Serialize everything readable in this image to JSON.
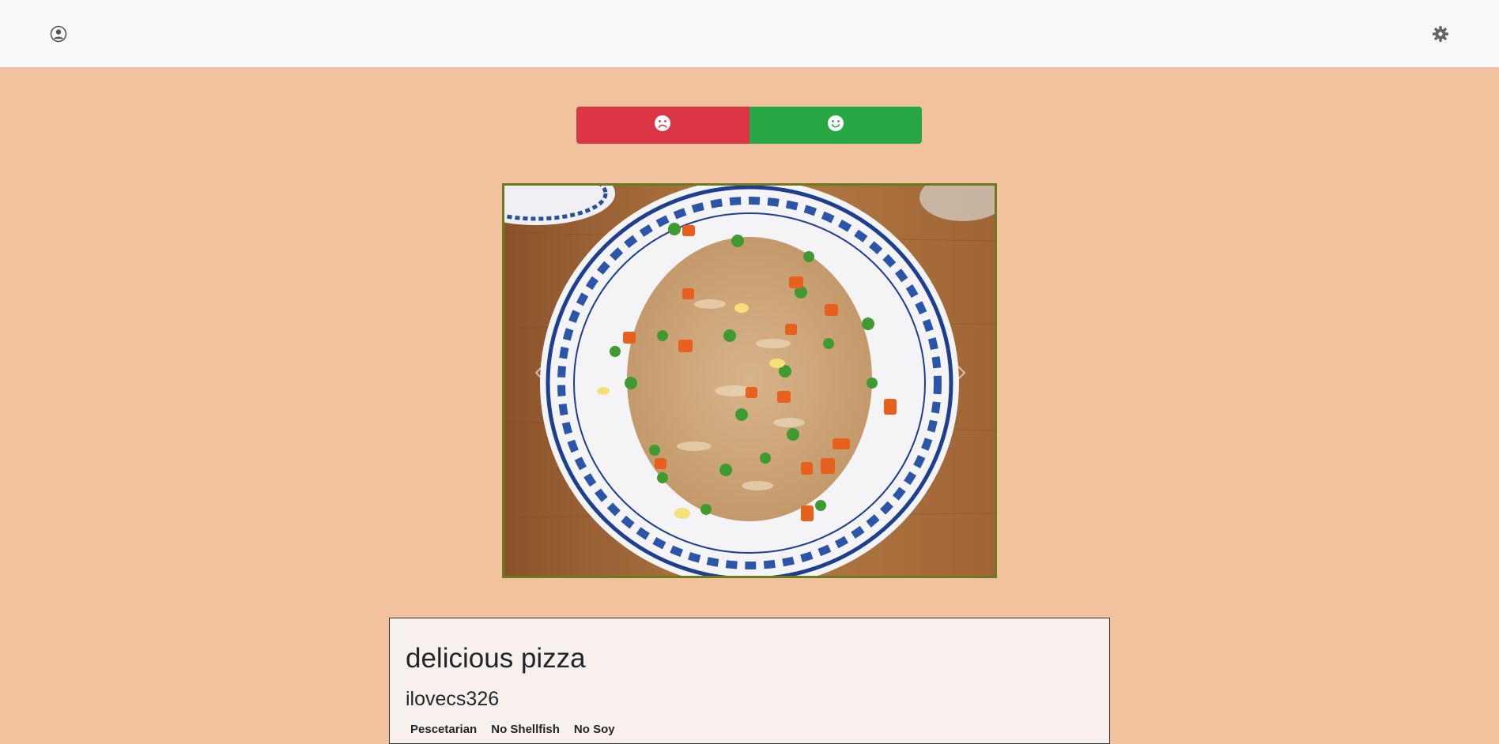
{
  "navbar": {
    "profile_icon": "user-circle-icon",
    "settings_icon": "gear-icon"
  },
  "vote": {
    "dislike_icon": "frown-icon",
    "like_icon": "smile-icon",
    "dislike_color": "#dc3545",
    "like_color": "#28a745"
  },
  "carousel": {
    "image_subject": "plate of fried rice",
    "prev_icon": "chevron-left-icon",
    "next_icon": "chevron-right-icon"
  },
  "recipe": {
    "title": "delicious pizza",
    "author": "ilovecs326",
    "tags": [
      "Pescetarian",
      "No Shellfish",
      "No Soy"
    ]
  },
  "colors": {
    "page_background": "#f2c19e",
    "navbar_background": "#f8f9fa",
    "card_background": "#f7f0ec",
    "photo_border": "#6b7a1e"
  }
}
